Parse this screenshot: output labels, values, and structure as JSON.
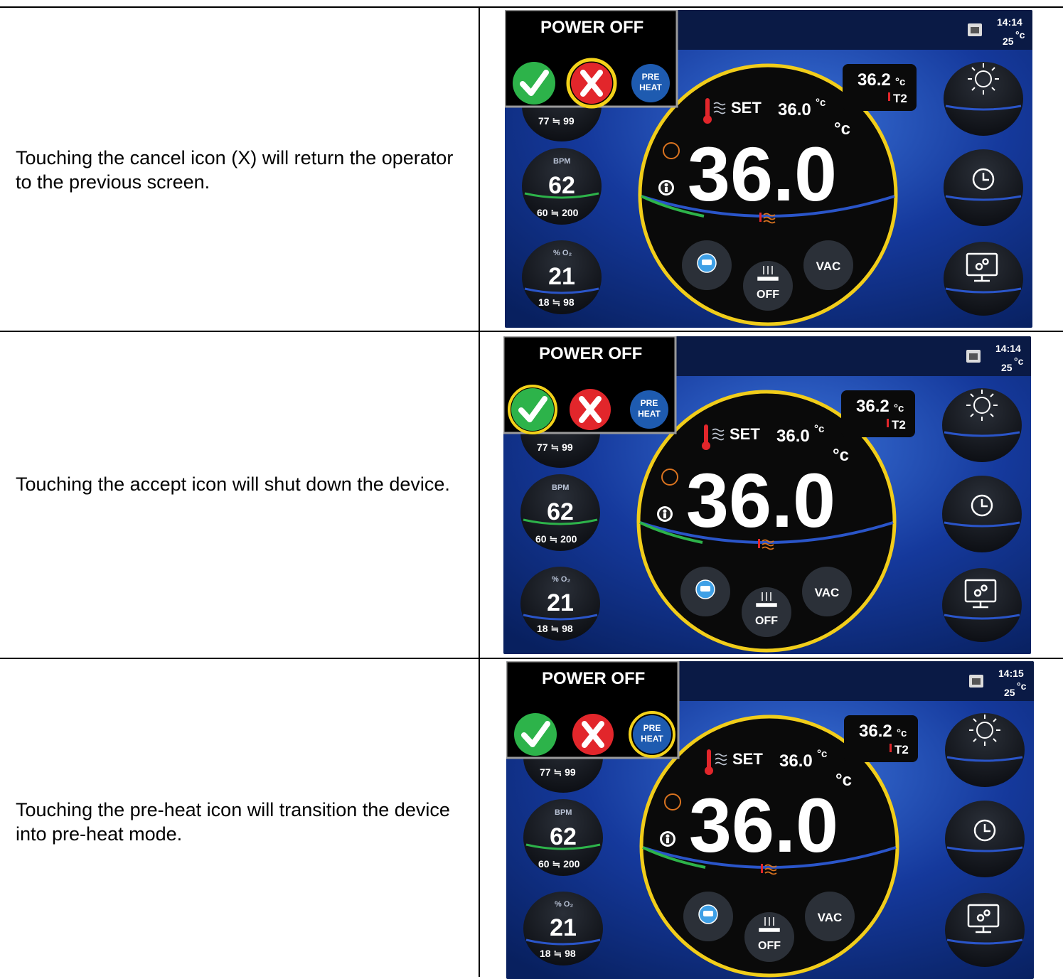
{
  "rows": [
    {
      "description": "Touching the cancel icon (X) will return the operator to the previous screen.",
      "highlight": "cancel",
      "screen": {
        "dialog_title": "POWER OFF",
        "preheat_line1": "PRE",
        "preheat_line2": "HEAT",
        "time": "14:14",
        "ambient": "25",
        "ambient_unit": "°c",
        "t2_value": "36.2",
        "t2_unit": "°c",
        "t2_label": "T2",
        "set_label": "SET",
        "set_value": "36.0",
        "set_unit": "°c",
        "main_value": "36.0",
        "main_unit": "°c",
        "spo2_range": "77 ≒ 99",
        "bpm_label": "BPM",
        "bpm_value": "62",
        "bpm_range": "60 ≒ 200",
        "o2_label": "% O₂",
        "o2_value": "21",
        "o2_range": "18 ≒ 98",
        "vac_label": "VAC",
        "heater_label": "OFF"
      }
    },
    {
      "description": "Touching the accept icon will shut down the device.",
      "highlight": "accept",
      "screen": {
        "dialog_title": "POWER OFF",
        "preheat_line1": "PRE",
        "preheat_line2": "HEAT",
        "time": "14:14",
        "ambient": "25",
        "ambient_unit": "°c",
        "t2_value": "36.2",
        "t2_unit": "°c",
        "t2_label": "T2",
        "set_label": "SET",
        "set_value": "36.0",
        "set_unit": "°c",
        "main_value": "36.0",
        "main_unit": "°c",
        "spo2_range": "77 ≒ 99",
        "bpm_label": "BPM",
        "bpm_value": "62",
        "bpm_range": "60 ≒ 200",
        "o2_label": "% O₂",
        "o2_value": "21",
        "o2_range": "18 ≒ 98",
        "vac_label": "VAC",
        "heater_label": "OFF"
      }
    },
    {
      "description": "Touching the pre-heat icon will transition the device into pre-heat mode.",
      "highlight": "preheat",
      "screen": {
        "dialog_title": "POWER OFF",
        "preheat_line1": "PRE",
        "preheat_line2": "HEAT",
        "time": "14:15",
        "ambient": "25",
        "ambient_unit": "°c",
        "t2_value": "36.2",
        "t2_unit": "°c",
        "t2_label": "T2",
        "set_label": "SET",
        "set_value": "36.0",
        "set_unit": "°c",
        "main_value": "36.0",
        "main_unit": "°c",
        "spo2_range": "77 ≒ 99",
        "bpm_label": "BPM",
        "bpm_value": "62",
        "bpm_range": "60 ≒ 200",
        "o2_label": "% O₂",
        "o2_value": "21",
        "o2_range": "18 ≒ 98",
        "vac_label": "VAC",
        "heater_label": "OFF"
      }
    }
  ],
  "colors": {
    "highlight_ring": "#f3d21a",
    "accept_green": "#2db34a",
    "cancel_red": "#e2262b",
    "preheat_blue": "#1e5bb0",
    "background_blue": "#0d2f8c",
    "dial_black": "#0a0a0a"
  },
  "icons": [
    "checkmark-icon",
    "x-icon",
    "thermometer-icon",
    "heat-waves-icon",
    "baby-icon",
    "clock-icon",
    "light-icon",
    "monitor-settings-icon",
    "camera-icon",
    "heater-icon",
    "calendar-icon"
  ]
}
